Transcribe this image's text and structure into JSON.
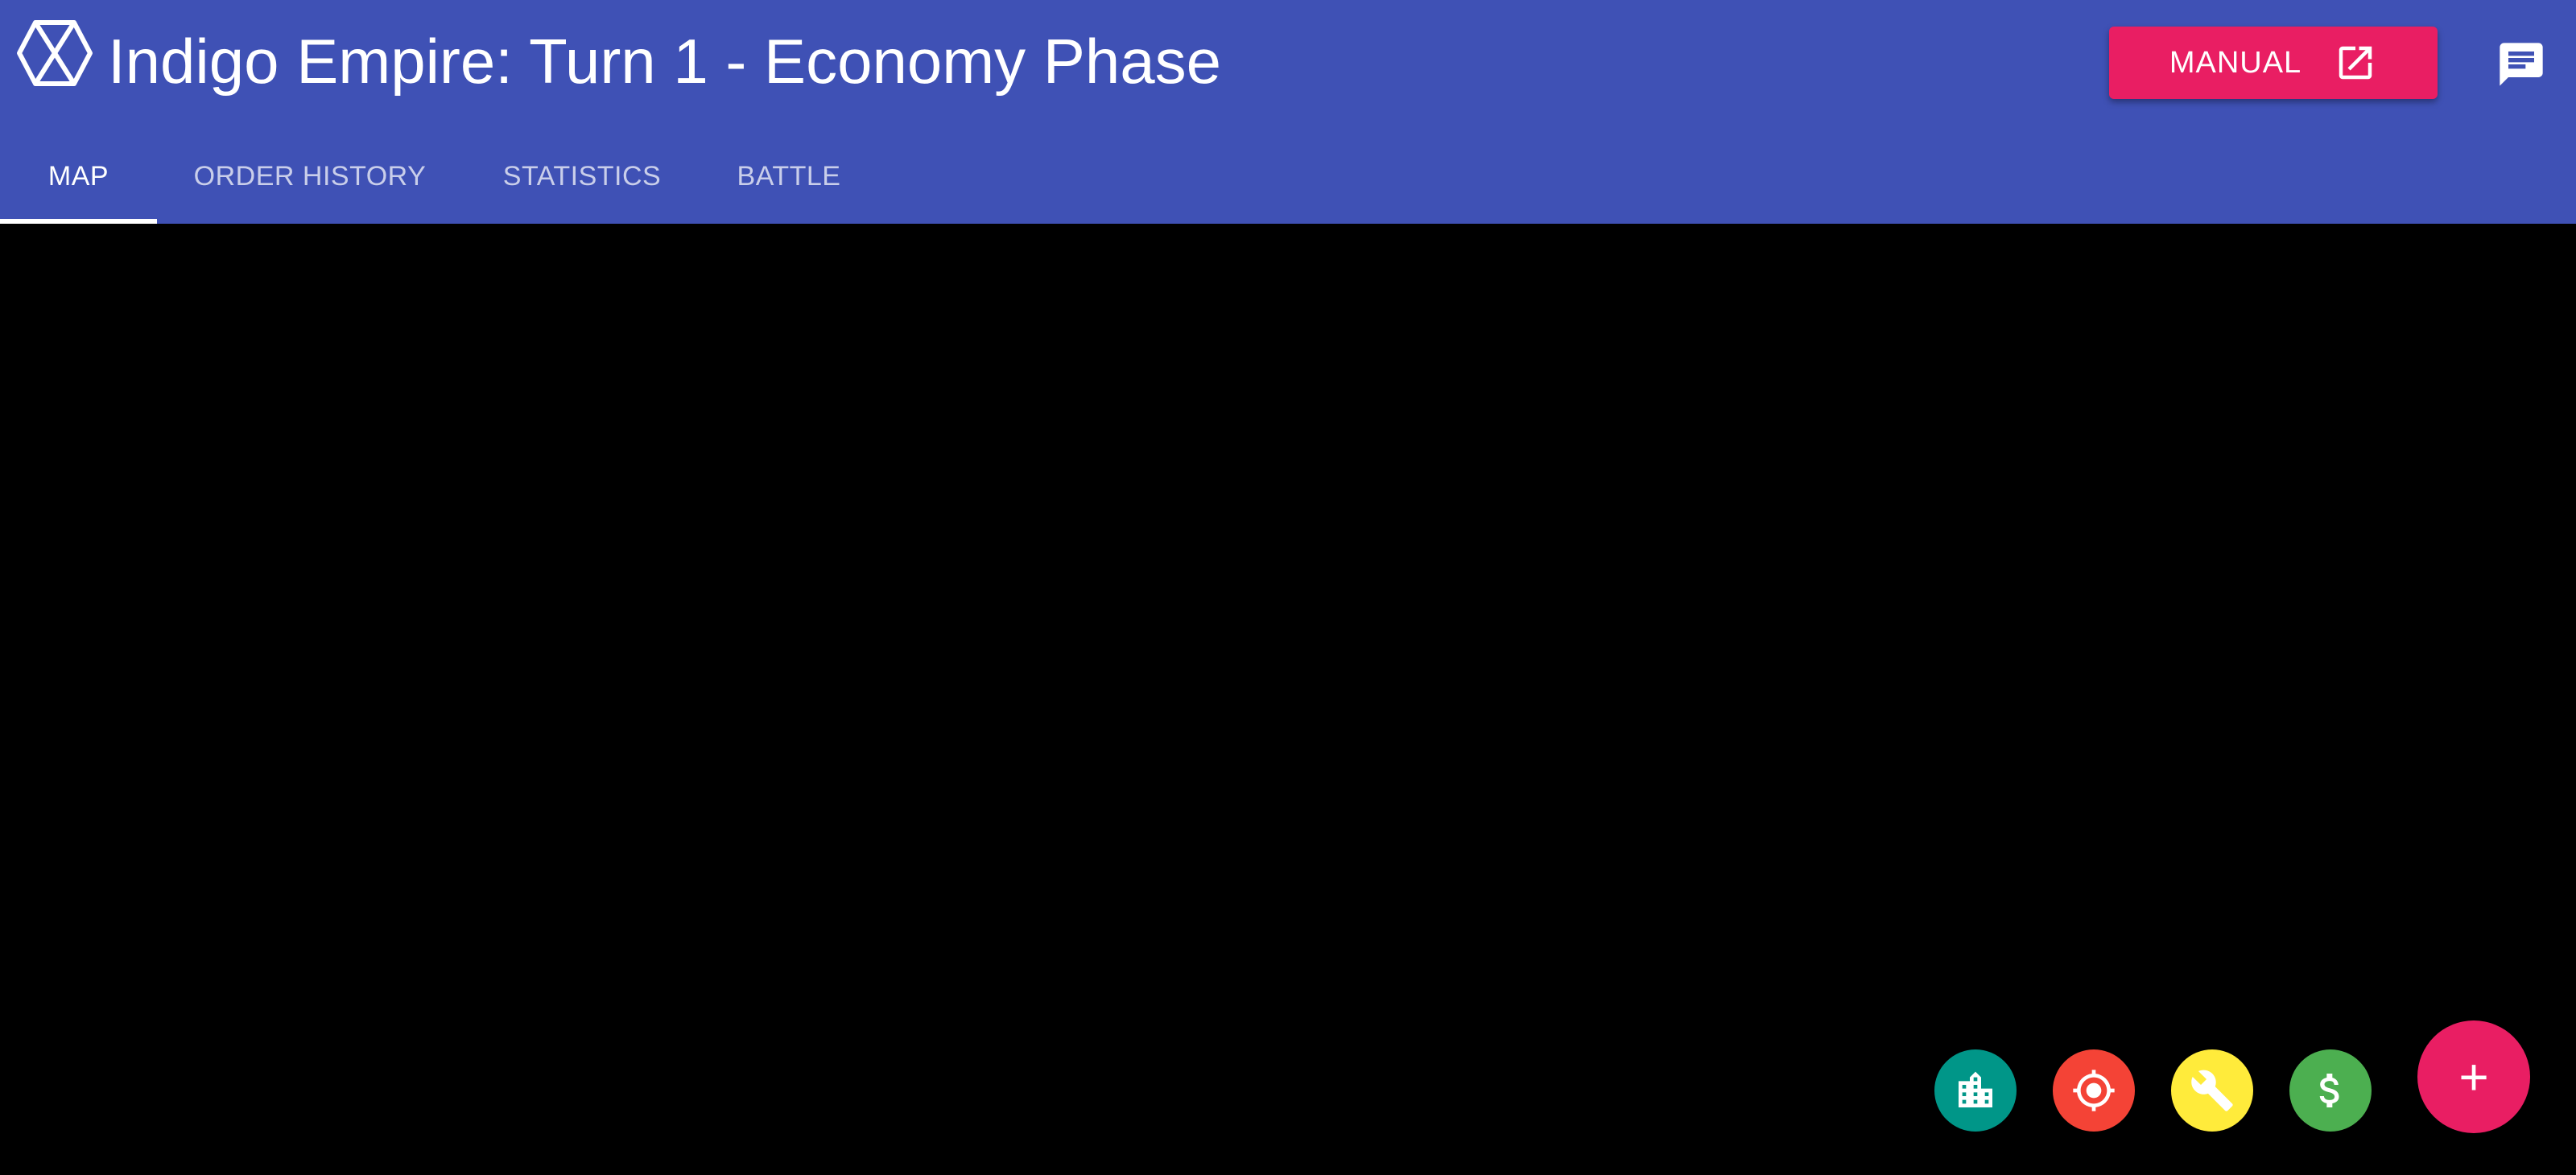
{
  "header": {
    "title": "Indigo Empire: Turn 1 - Economy Phase",
    "logo_icon": "hexagon-x-logo-icon",
    "manual_label": "MANUAL",
    "manual_icon": "open-in-new-icon",
    "chat_icon": "chat-icon",
    "background_color": "#3f51b5"
  },
  "tabs": [
    {
      "label": "MAP",
      "active": true
    },
    {
      "label": "ORDER HISTORY",
      "active": false
    },
    {
      "label": "STATISTICS",
      "active": false
    },
    {
      "label": "BATTLE",
      "active": false
    }
  ],
  "fab_actions": [
    {
      "icon": "city-icon",
      "color": "#009688"
    },
    {
      "icon": "target-icon",
      "color": "#f44336"
    },
    {
      "icon": "wrench-icon",
      "color": "#ffeb3b"
    },
    {
      "icon": "dollar-icon",
      "color": "#4caf50"
    }
  ],
  "fab_main": {
    "icon": "plus-icon",
    "label": "+",
    "color": "#e91e63"
  },
  "colors": {
    "accent": "#e91e63",
    "map_background": "#000000"
  }
}
